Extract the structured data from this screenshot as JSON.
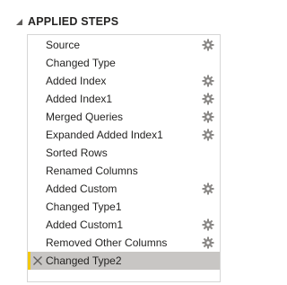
{
  "panel": {
    "title": "APPLIED STEPS",
    "accent_color": "#f2c811"
  },
  "steps": [
    {
      "label": "Source",
      "has_settings": true
    },
    {
      "label": "Changed Type",
      "has_settings": false
    },
    {
      "label": "Added Index",
      "has_settings": true
    },
    {
      "label": "Added Index1",
      "has_settings": true
    },
    {
      "label": "Merged Queries",
      "has_settings": true
    },
    {
      "label": "Expanded Added Index1",
      "has_settings": true
    },
    {
      "label": "Sorted Rows",
      "has_settings": false
    },
    {
      "label": "Renamed Columns",
      "has_settings": false
    },
    {
      "label": "Added Custom",
      "has_settings": true
    },
    {
      "label": "Changed Type1",
      "has_settings": false
    },
    {
      "label": "Added Custom1",
      "has_settings": true
    },
    {
      "label": "Removed Other Columns",
      "has_settings": true
    },
    {
      "label": "Changed Type2",
      "has_settings": false,
      "selected": true
    }
  ],
  "icons": {
    "collapse": "collapse-triangle-icon",
    "settings": "gear-icon",
    "delete": "delete-x-icon"
  }
}
